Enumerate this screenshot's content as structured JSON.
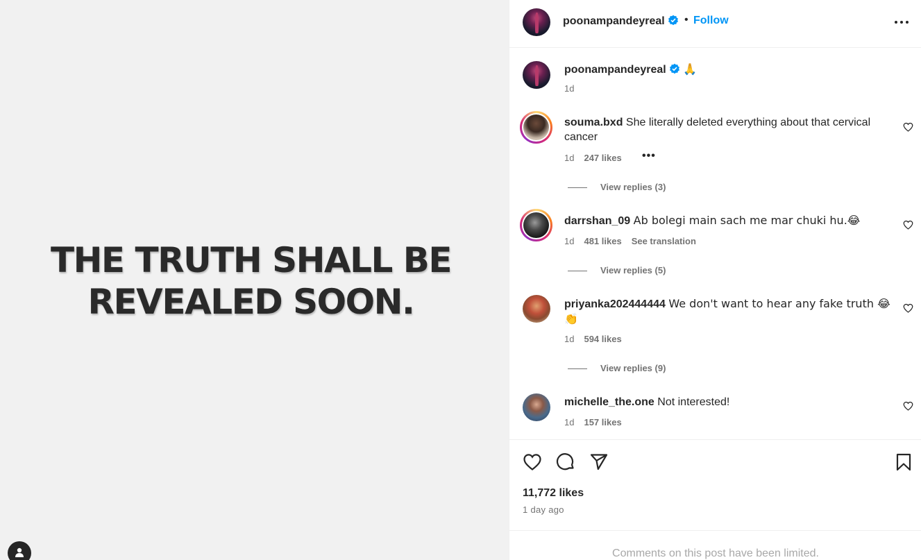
{
  "media": {
    "headline_line1": "THE TRUTH SHALL BE",
    "headline_line2": "REVEALED SOON."
  },
  "header": {
    "username": "poonampandeyreal",
    "separator": "•",
    "follow_label": "Follow",
    "more_icon": "ellipsis-icon"
  },
  "caption": {
    "username": "poonampandeyreal",
    "text": "🙏",
    "time": "1d"
  },
  "comments": [
    {
      "username": "souma.bxd",
      "text": "She literally deleted everything about that cervical cancer",
      "time": "1d",
      "likes": "247 likes",
      "extra": "•••",
      "replies": "View replies (3)"
    },
    {
      "username": "darrshan_09",
      "text": "Ab bolegi main sach me mar chuki hu.😂",
      "time": "1d",
      "likes": "481 likes",
      "extra": "See translation",
      "replies": "View replies (5)"
    },
    {
      "username": "priyanka202444444",
      "text": "We don't want to hear any fake truth 😂👏",
      "time": "1d",
      "likes": "594 likes",
      "replies": "View replies (9)"
    },
    {
      "username": "michelle_the.one",
      "text": "Not interested!",
      "time": "1d",
      "likes": "157 likes"
    }
  ],
  "footer": {
    "likes": "11,772 likes",
    "time_ago": "1 day ago",
    "limited_notice": "Comments on this post have been limited."
  },
  "colors": {
    "link_blue": "#0095f6",
    "verified_blue": "#0095f6",
    "muted": "#737373",
    "media_bg": "#f1f1f1"
  }
}
